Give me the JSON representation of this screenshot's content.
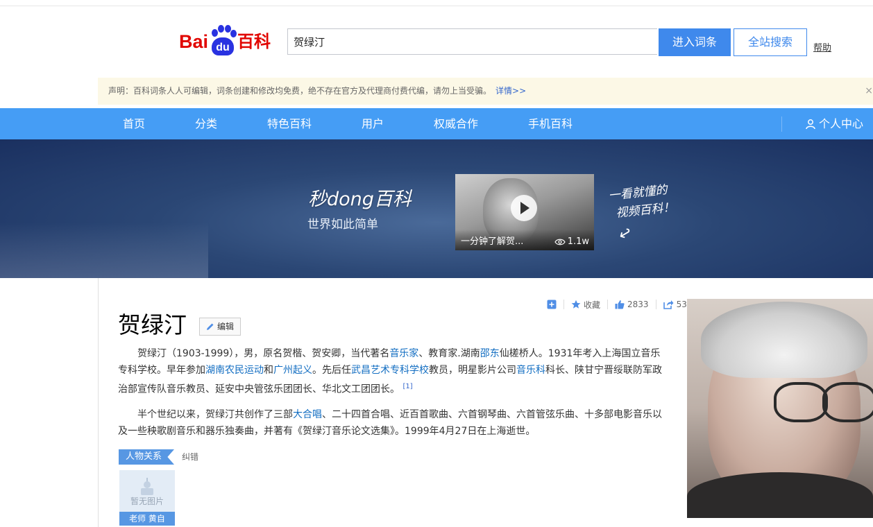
{
  "header": {
    "logo_bai": "Bai",
    "logo_du": "du",
    "logo_baike": "百科",
    "search_value": "贺绿汀",
    "enter_entry_label": "进入词条",
    "site_search_label": "全站搜索",
    "help_label": "帮助"
  },
  "notice": {
    "text": "声明：百科词条人人可编辑，词条创建和修改均免费，绝不存在官方及代理商付费代编，请勿上当受骗。",
    "more_label": "详情>>",
    "close_glyph": "×"
  },
  "nav": {
    "items": [
      "首页",
      "分类",
      "特色百科",
      "用户",
      "权威合作",
      "手机百科"
    ],
    "user_center": "个人中心"
  },
  "banner": {
    "logo_text": "秒dong百科",
    "subtitle": "世界如此简单",
    "video_caption": "一分钟了解贺...",
    "video_views": "1.1w",
    "handwriting_line1": "一看就懂的",
    "handwriting_line2": "视频百科！"
  },
  "article": {
    "title": "贺绿汀",
    "edit_label": "编辑",
    "toolbar": {
      "collect_label": "收藏",
      "likes": "2833",
      "shares": "53"
    },
    "para1": {
      "t1": "贺绿汀（1903-1999），男，原名贺楷、贺安卿，当代著名",
      "l1": "音乐家",
      "t2": "、教育家.湖南",
      "l2": "邵东",
      "t3": "仙槎桥人。1931年考入上海国立音乐专科学校。早年参加",
      "l3": "湖南农民运动",
      "t4": "和",
      "l4": "广州起义",
      "t5": "。先后任",
      "l5": "武昌艺术专科学校",
      "t6": "教员，明星影片公司",
      "l6": "音乐科",
      "t7": "科长、陕甘宁晋绥联防军政治部宣传队音乐教员、延安中央管弦乐团团长、华北文工团团长。",
      "ref": "[1]"
    },
    "para2": {
      "t1": "半个世纪以来，贺绿汀共创作了三部",
      "l1": "大合唱",
      "t2": "、二十四首合唱、近百首歌曲、六首钢琴曲、六首管弦乐曲、十多部电影音乐以及一些秧歌剧音乐和器乐独奏曲，并著有《贺绿汀音乐论文选集》。1999年4月27日在上海逝世。"
    },
    "relations_label": "人物关系",
    "correction_label": "纠错",
    "person_card": {
      "no_image": "暂无图片",
      "name": "老师 黄自"
    }
  },
  "colors": {
    "nav_blue": "#459df5",
    "button_blue": "#3f89ec",
    "link_blue": "#136ec2",
    "notice_bg": "#fcf8e6",
    "logo_red": "#e10601"
  }
}
